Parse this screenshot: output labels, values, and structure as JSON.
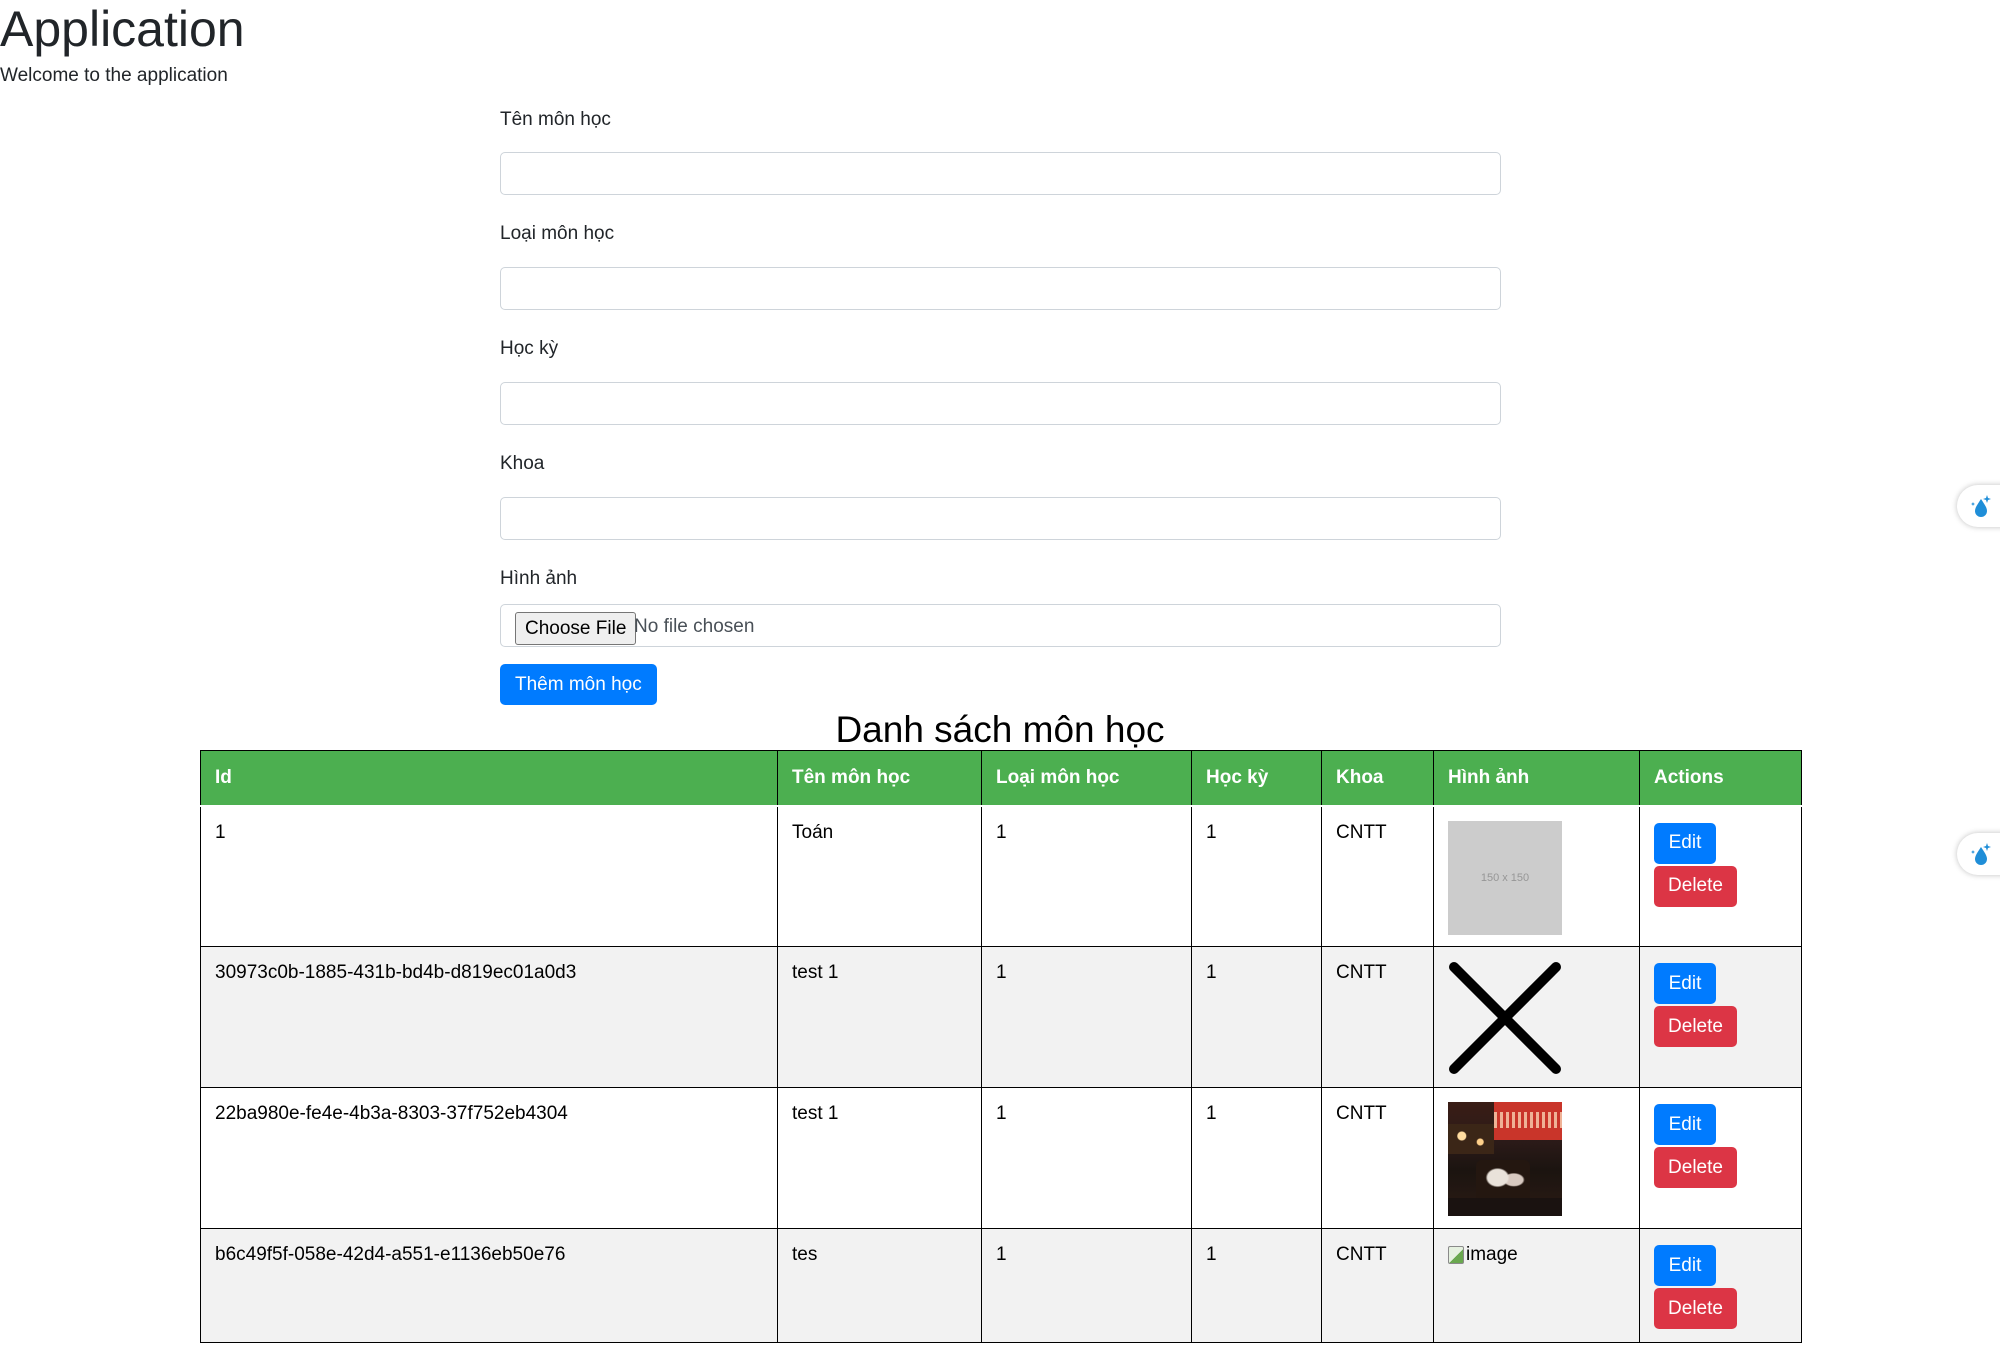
{
  "header": {
    "title": "Application",
    "welcome": "Welcome to the application"
  },
  "form": {
    "fields": [
      {
        "label": "Tên môn học",
        "value": ""
      },
      {
        "label": "Loại môn học",
        "value": ""
      },
      {
        "label": "Học kỳ",
        "value": ""
      },
      {
        "label": "Khoa",
        "value": ""
      }
    ],
    "image_label": "Hình ảnh",
    "choose_file_label": "Choose File",
    "no_file_text": "No file chosen",
    "submit_label": "Thêm môn học"
  },
  "list": {
    "title": "Danh sách môn học",
    "columns": [
      "Id",
      "Tên môn học",
      "Loại môn học",
      "Học kỳ",
      "Khoa",
      "Hình ảnh",
      "Actions"
    ],
    "rows": [
      {
        "id": "1",
        "name": "Toán",
        "type": "1",
        "semester": "1",
        "faculty": "CNTT",
        "image": "placeholder",
        "image_text": "150 x 150"
      },
      {
        "id": "30973c0b-1885-431b-bd4b-d819ec01a0d3",
        "name": "test 1",
        "type": "1",
        "semester": "1",
        "faculty": "CNTT",
        "image": "x-icon"
      },
      {
        "id": "22ba980e-fe4e-4b3a-8303-37f752eb4304",
        "name": "test 1",
        "type": "1",
        "semester": "1",
        "faculty": "CNTT",
        "image": "photo"
      },
      {
        "id": "b6c49f5f-058e-42d4-a551-e1136eb50e76",
        "name": "tes",
        "type": "1",
        "semester": "1",
        "faculty": "CNTT",
        "image": "broken",
        "image_alt": "image"
      }
    ],
    "edit_label": "Edit",
    "delete_label": "Delete"
  },
  "colors": {
    "primary": "#007bff",
    "danger": "#dc3545",
    "table_header": "#4caf50",
    "row_alt": "#f2f2f2"
  }
}
